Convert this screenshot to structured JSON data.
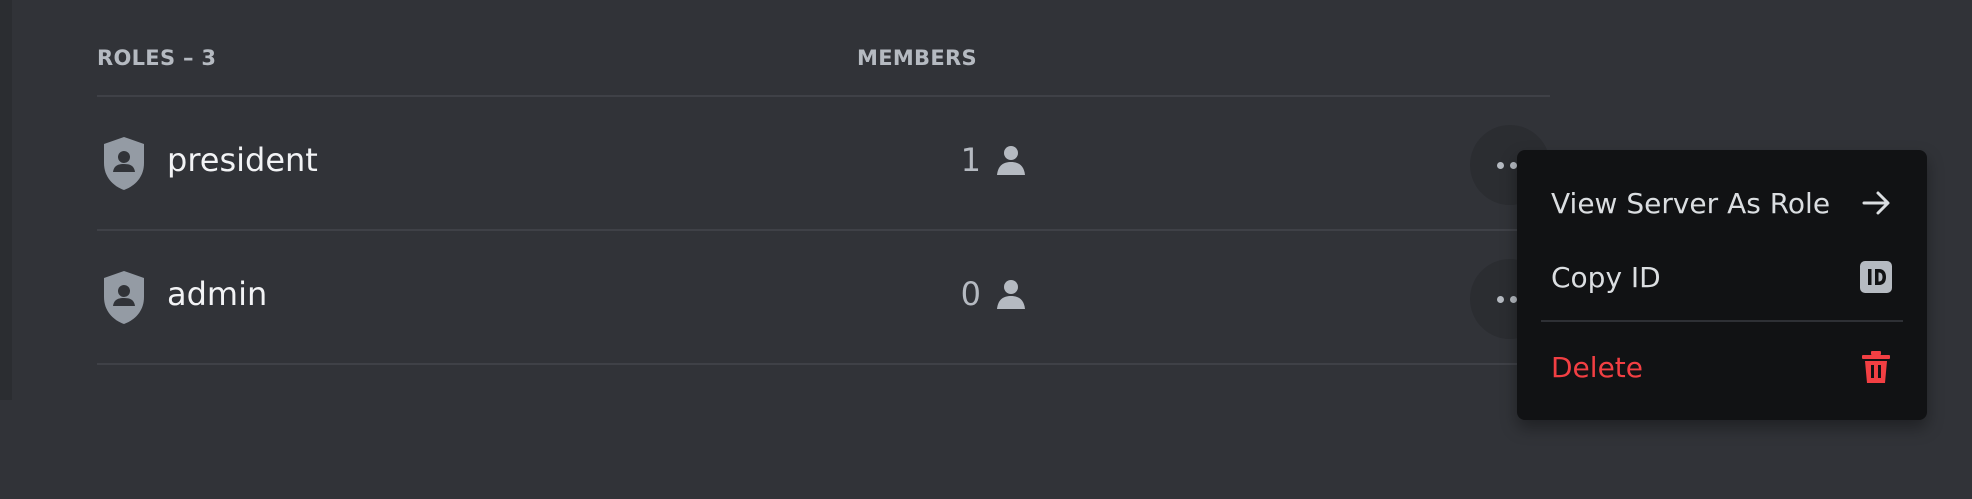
{
  "header": {
    "roles_label": "ROLES – 3",
    "members_label": "MEMBERS"
  },
  "roles": [
    {
      "name": "president",
      "member_count": "1"
    },
    {
      "name": "admin",
      "member_count": "0"
    }
  ],
  "context_menu": {
    "items": [
      {
        "label": "View Server As Role",
        "icon": "arrow-right-icon"
      },
      {
        "label": "Copy ID",
        "icon": "id-badge-icon"
      },
      {
        "label": "Delete",
        "icon": "trash-icon"
      }
    ],
    "delete_color": "#f23f43"
  },
  "colors": {
    "background": "#313338",
    "menu_background": "#111214",
    "role_icon": "#949ba4"
  }
}
